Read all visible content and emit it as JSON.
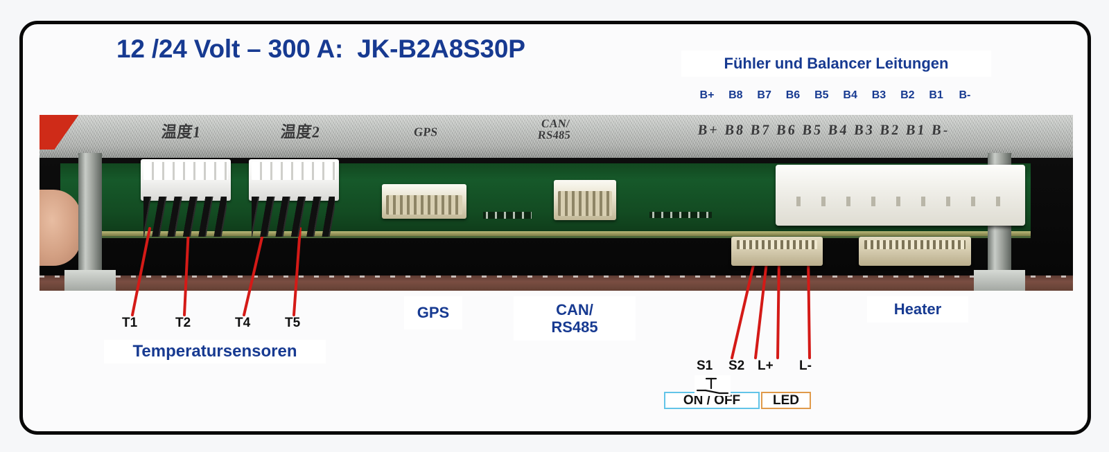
{
  "title": "12 /24 Volt – 300 A:  JK-B2A8S30P",
  "callouts": {
    "fuehler": "Fühler und Balancer Leitungen",
    "temperatur": "Temperatursensoren",
    "gps": "GPS",
    "can": "CAN/\nRS485",
    "heater": "Heater"
  },
  "balancer_pins": [
    "B+",
    "B8",
    "B7",
    "B6",
    "B5",
    "B4",
    "B3",
    "B2",
    "B1",
    "B-"
  ],
  "temp_sensor_labels": [
    "T1",
    "T2",
    "T4",
    "T5"
  ],
  "switch_pin_labels": [
    "S1",
    "S2",
    "L+",
    "L-"
  ],
  "switch_boxes": {
    "onoff": "ON / OFF",
    "led": "LED"
  },
  "pcb_silkscreen": {
    "temp1": "温度1",
    "temp2": "温度2",
    "gps": "GPS",
    "can": "CAN/\nRS485",
    "balancer": "B+ B8 B7 B6 B5 B4 B3 B2 B1 B-"
  },
  "colors": {
    "title_blue": "#173a91",
    "leader_red": "#d41a17",
    "frame_black": "#080808",
    "onoff_border": "#62c4e8",
    "led_border": "#e09a4a",
    "label_black": "#111111"
  }
}
